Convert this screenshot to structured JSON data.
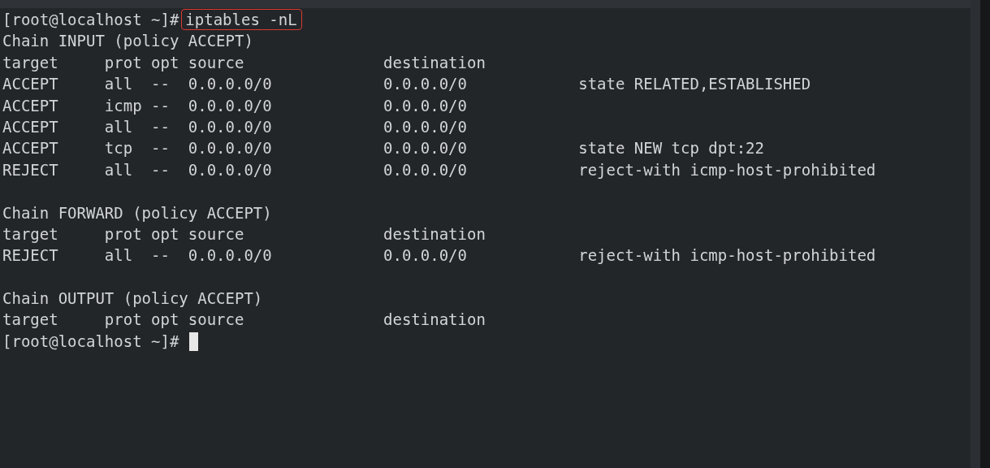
{
  "terminal": {
    "lines": [
      {
        "kind": "prompt",
        "prompt": "[root@localhost ~]#",
        "command": "iptables -nL",
        "highlighted": true
      },
      {
        "kind": "output",
        "text": "Chain INPUT (policy ACCEPT)"
      },
      {
        "kind": "output",
        "text": "target     prot opt source               destination"
      },
      {
        "kind": "output",
        "text": "ACCEPT     all  --  0.0.0.0/0            0.0.0.0/0            state RELATED,ESTABLISHED"
      },
      {
        "kind": "output",
        "text": "ACCEPT     icmp --  0.0.0.0/0            0.0.0.0/0"
      },
      {
        "kind": "output",
        "text": "ACCEPT     all  --  0.0.0.0/0            0.0.0.0/0"
      },
      {
        "kind": "output",
        "text": "ACCEPT     tcp  --  0.0.0.0/0            0.0.0.0/0            state NEW tcp dpt:22"
      },
      {
        "kind": "output",
        "text": "REJECT     all  --  0.0.0.0/0            0.0.0.0/0            reject-with icmp-host-prohibited"
      },
      {
        "kind": "blank"
      },
      {
        "kind": "output",
        "text": "Chain FORWARD (policy ACCEPT)"
      },
      {
        "kind": "output",
        "text": "target     prot opt source               destination"
      },
      {
        "kind": "output",
        "text": "REJECT     all  --  0.0.0.0/0            0.0.0.0/0            reject-with icmp-host-prohibited"
      },
      {
        "kind": "blank"
      },
      {
        "kind": "output",
        "text": "Chain OUTPUT (policy ACCEPT)"
      },
      {
        "kind": "output",
        "text": "target     prot opt source               destination"
      },
      {
        "kind": "prompt",
        "prompt": "[root@localhost ~]#",
        "cursor": true
      }
    ]
  }
}
